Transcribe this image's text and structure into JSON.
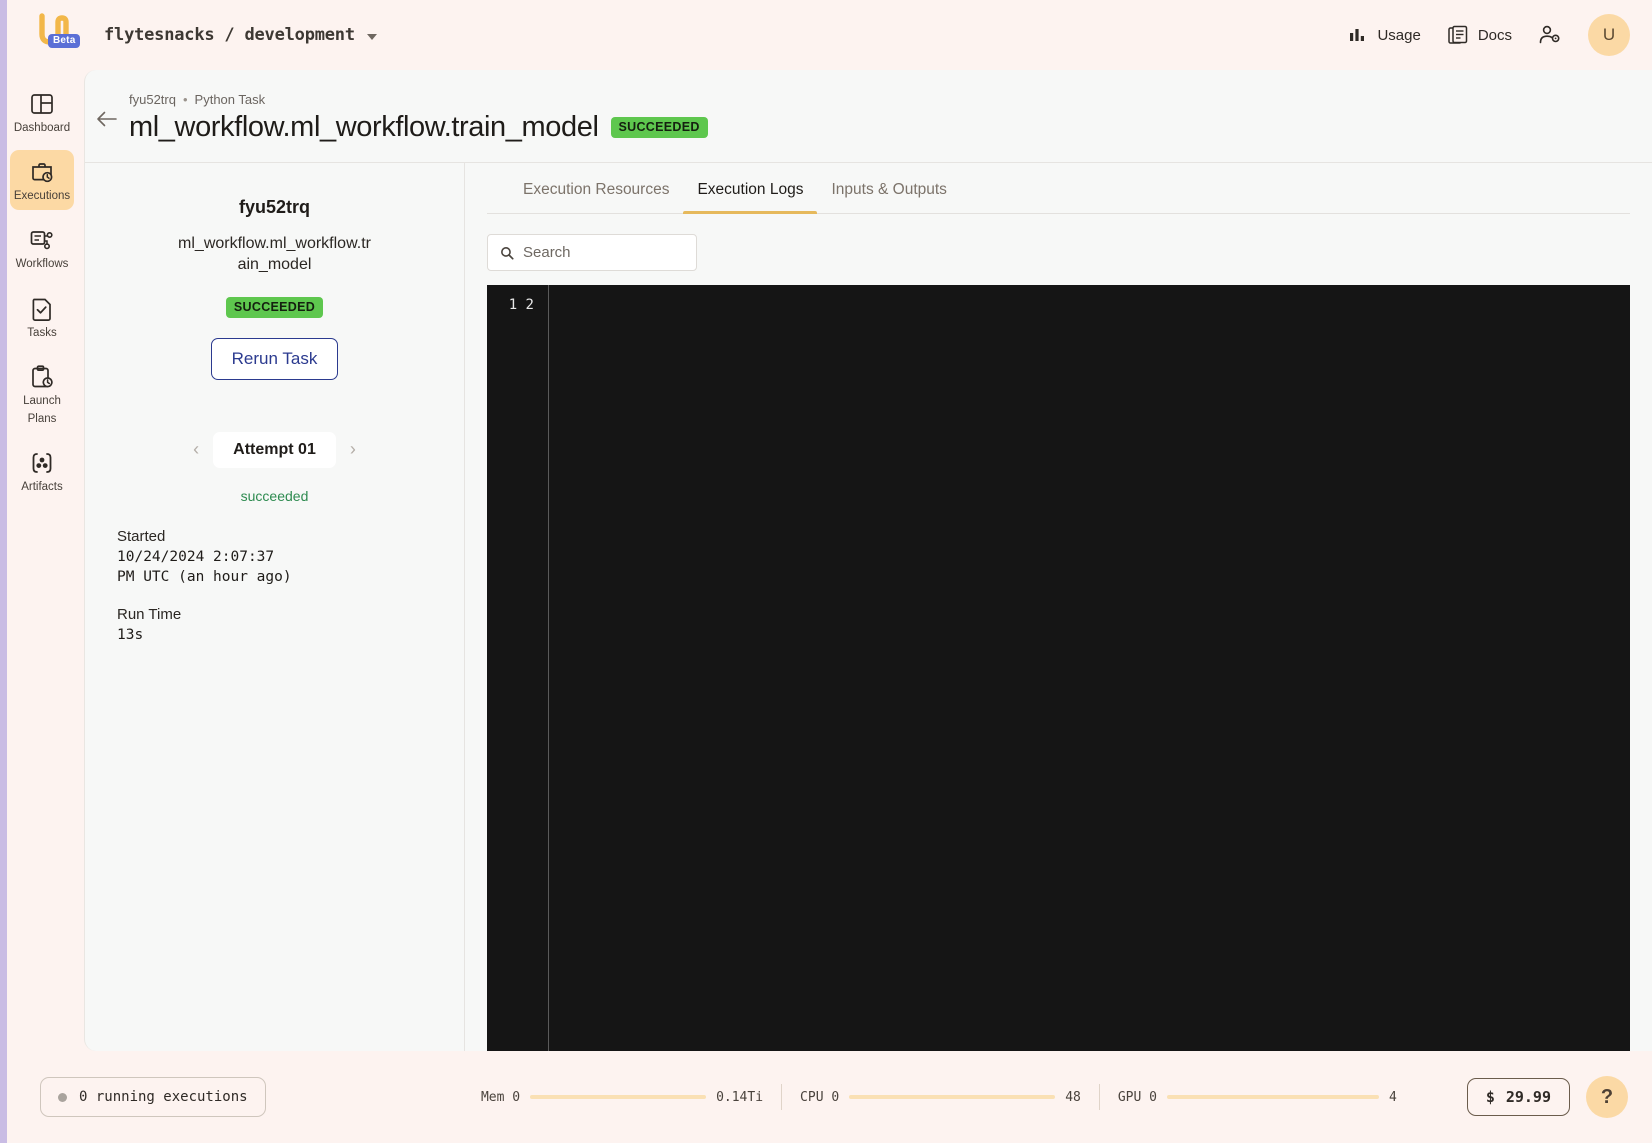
{
  "topbar": {
    "logo_name": "union-logo",
    "beta_label": "Beta",
    "breadcrumb": "flytesnacks / development",
    "usage_label": "Usage",
    "docs_label": "Docs",
    "avatar_initial": "U"
  },
  "sidebar": {
    "items": [
      {
        "label": "Dashboard",
        "icon": "dashboard-icon",
        "active": false
      },
      {
        "label": "Executions",
        "icon": "executions-icon",
        "active": true
      },
      {
        "label": "Workflows",
        "icon": "workflows-icon",
        "active": false
      },
      {
        "label": "Tasks",
        "icon": "tasks-icon",
        "active": false
      },
      {
        "label": "Launch\nPlans",
        "label_line1": "Launch",
        "label_line2": "Plans",
        "icon": "launch-plans-icon",
        "active": false
      },
      {
        "label": "Artifacts",
        "icon": "artifacts-icon",
        "active": false
      }
    ]
  },
  "page_header": {
    "breadcrumb_id": "fyu52trq",
    "breadcrumb_sep": "•",
    "breadcrumb_type": "Python Task",
    "title": "ml_workflow.ml_workflow.train_model",
    "status_badge": "SUCCEEDED",
    "status_color": "#5ec74e"
  },
  "detail_panel": {
    "execution_id": "fyu52trq",
    "task_name": "ml_workflow.ml_workflow.train_model",
    "status_badge": "SUCCEEDED",
    "rerun_label": "Rerun Task",
    "attempt_label": "Attempt 01",
    "attempt_status": "succeeded",
    "started_label": "Started",
    "started_value": "10/24/2024 2:07:37 PM UTC (an hour ago)",
    "runtime_label": "Run Time",
    "runtime_value": "13s"
  },
  "tabs": [
    {
      "label": "Execution Resources",
      "active": false
    },
    {
      "label": "Execution Logs",
      "active": true
    },
    {
      "label": "Inputs & Outputs",
      "active": false
    }
  ],
  "search": {
    "placeholder": "Search",
    "value": ""
  },
  "logs": {
    "line_numbers": "1\n2",
    "content": "",
    "background": "#151515"
  },
  "statusbar": {
    "running_executions": "0 running executions",
    "meters": [
      {
        "name": "Mem 0",
        "max": "0.14Ti",
        "fill_pct": 0
      },
      {
        "name": "CPU 0",
        "max": "48",
        "fill_pct": 0
      },
      {
        "name": "GPU 0",
        "max": "4",
        "fill_pct": 0
      }
    ],
    "cost_symbol": "$",
    "cost_value": "29.99",
    "help_label": "?"
  }
}
